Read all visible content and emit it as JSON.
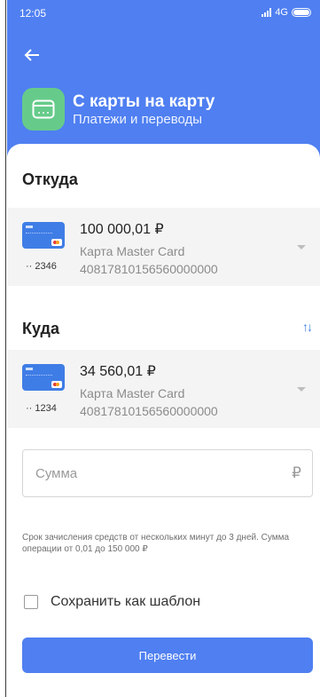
{
  "status_bar": {
    "time": "12:05",
    "network": "4G"
  },
  "header": {
    "title": "С карты на карту",
    "subtitle": "Платежи и переводы",
    "back_icon": "arrow-left-icon",
    "app_icon": "wallet-icon"
  },
  "from": {
    "title": "Откуда",
    "card": {
      "amount": "100 000,01 ₽",
      "name": "Карта Master Card",
      "account": "40817810156560000000",
      "last_digits": "·· 2346"
    }
  },
  "to": {
    "title": "Куда",
    "swap_icon": "swap-vertical-icon",
    "card": {
      "amount": "34 560,01 ₽",
      "name": "Карта Master Card",
      "account": "40817810156560000000",
      "last_digits": "·· 1234"
    }
  },
  "amount_field": {
    "placeholder": "Сумма",
    "currency": "₽"
  },
  "hint": "Срок зачисления средств от нескольких минут до 3 дней. Сумма операции от 0,01 до 150 000 ₽",
  "save_template": {
    "label": "Сохранить как шаблон",
    "checked": false
  },
  "submit_button": {
    "label": "Перевести"
  },
  "colors": {
    "accent": "#4f7ff1",
    "icon_green": "#66cb8a",
    "card_blue": "#3f7de6"
  }
}
